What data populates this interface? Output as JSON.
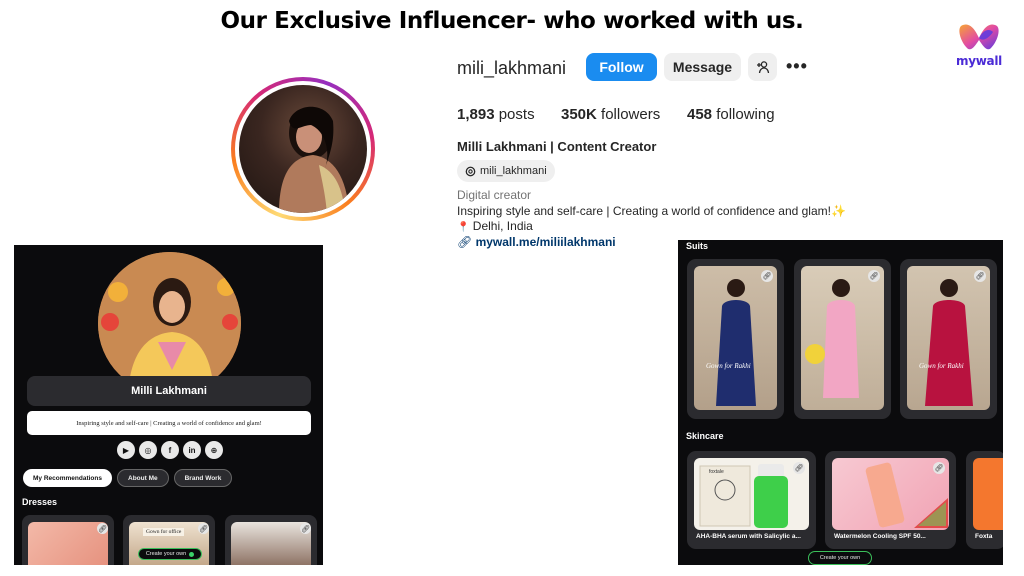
{
  "heading": "Our Exclusive Influencer- who worked with us.",
  "brand": {
    "logo_text": "mywall",
    "colors": [
      "#f7a534",
      "#e24ba3",
      "#5b3be0"
    ]
  },
  "profile": {
    "username": "mili_lakhmani",
    "follow_label": "Follow",
    "message_label": "Message",
    "add_user_icon": "add-user-icon",
    "more_icon": "•••",
    "stats": {
      "posts_count": "1,893",
      "posts_label": "posts",
      "followers_count": "350K",
      "followers_label": "followers",
      "following_count": "458",
      "following_label": "following"
    },
    "full_name": "Milli Lakhmani | Content Creator",
    "threads_handle": "mili_lakhmani",
    "category": "Digital creator",
    "bio": "Inspiring style and self-care | Creating a world of confidence and glam!✨",
    "location_pin": "📍",
    "location": "Delhi, India",
    "link": "mywall.me/miliilakhmani",
    "accent_color": "#1a8cf0"
  },
  "mywall_page": {
    "name": "Milli Lakhmani",
    "bio": "Inspiring style and self-care | Creating a world of confidence and glam!",
    "socials": [
      "youtube-icon",
      "instagram-icon",
      "facebook-icon",
      "linkedin-icon",
      "globe-icon"
    ],
    "social_glyphs": [
      "▶",
      "◎",
      "f",
      "in",
      "⊕"
    ],
    "tabs": [
      "My Recommendations",
      "About Me",
      "Brand Work"
    ],
    "active_tab": "My Recommendations",
    "section": "Dresses",
    "card_overlay": "Gown for office",
    "create_label": "Create your own"
  },
  "collection_page": {
    "sections": [
      "Suits",
      "Skincare"
    ],
    "suits_watermarks": [
      "Gown for Rakhi",
      "Gown for Rakhi"
    ],
    "products": [
      "AHA-BHA serum with Salicylic a...",
      "Watermelon Cooling SPF 50...",
      "Foxta"
    ],
    "product_brand": "foxtale",
    "create_label": "Create your own"
  }
}
